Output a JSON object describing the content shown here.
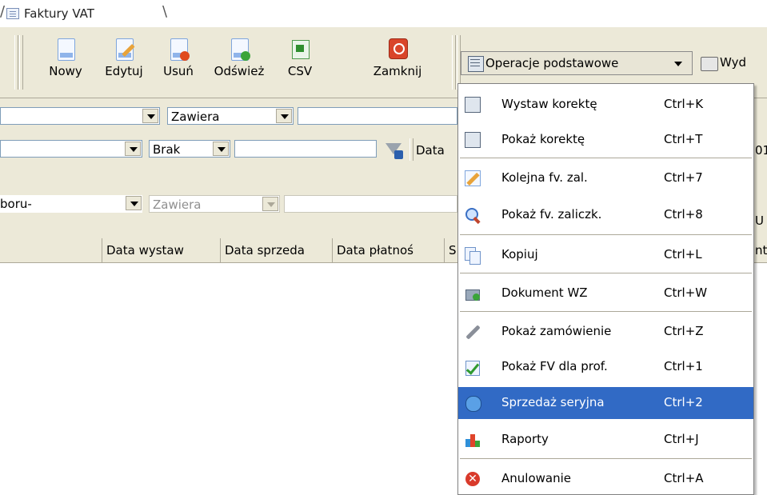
{
  "tab": {
    "label": "Faktury VAT",
    "accel": "F"
  },
  "toolbar": {
    "buttons": [
      {
        "label": "Nowy"
      },
      {
        "label": "Edytuj"
      },
      {
        "label": "Usuń"
      },
      {
        "label": "Odśwież"
      },
      {
        "label": "CSV"
      },
      {
        "label": "Zamknij"
      }
    ],
    "ops_label": "Operacje podstawowe",
    "print_label": "Wyd"
  },
  "filters": {
    "row1_op": "Zawiera",
    "row2_op": "Brak",
    "row2_text": "Data",
    "row2_right": "01",
    "row3_combo": "boru-",
    "row3_op": "Zawiera",
    "row3_right": "U"
  },
  "grid": {
    "headers": [
      "Data wystaw",
      "Data sprzeda",
      "Data płatnoś",
      "S"
    ],
    "right_header": "nta"
  },
  "menu": {
    "items": [
      {
        "label": "Wystaw korektę",
        "shortcut": "Ctrl+K",
        "icon": "grid-doc-icon"
      },
      {
        "label": "Pokaż korektę",
        "shortcut": "Ctrl+T",
        "icon": "grid-doc-icon"
      },
      {
        "label": "Kolejna fv. zal.",
        "shortcut": "Ctrl+7",
        "icon": "edit-icon"
      },
      {
        "label": "Pokaż fv. zaliczk.",
        "shortcut": "Ctrl+8",
        "icon": "magnifier-icon"
      },
      {
        "label": "Kopiuj",
        "shortcut": "Ctrl+L",
        "icon": "copy-icon"
      },
      {
        "label": "Dokument WZ",
        "shortcut": "Ctrl+W",
        "icon": "package-add-icon"
      },
      {
        "label": "Pokaż zamówienie",
        "shortcut": "Ctrl+Z",
        "icon": "wrench-icon"
      },
      {
        "label": "Pokaż FV dla prof.",
        "shortcut": "Ctrl+1",
        "icon": "checklist-icon"
      },
      {
        "label": "Sprzedaż seryjna",
        "shortcut": "Ctrl+2",
        "icon": "cube-icon",
        "highlighted": true
      },
      {
        "label": "Raporty",
        "shortcut": "Ctrl+J",
        "icon": "chart-icon"
      },
      {
        "label": "Anulowanie",
        "shortcut": "Ctrl+A",
        "icon": "cancel-icon"
      }
    ]
  },
  "colors": {
    "highlight": "#316ac5",
    "face": "#ece9d8",
    "border": "#7f9db9"
  }
}
